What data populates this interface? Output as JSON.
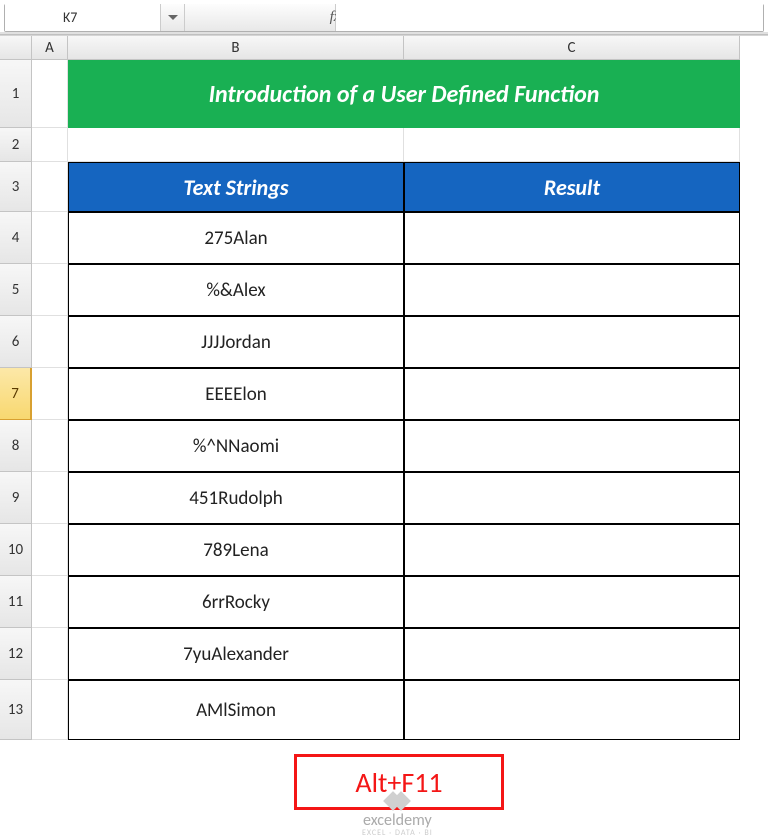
{
  "name_box": {
    "value": "K7"
  },
  "fx_label": "fx",
  "formula_value": "",
  "columns": [
    "A",
    "B",
    "C"
  ],
  "rows": [
    "1",
    "2",
    "3",
    "4",
    "5",
    "6",
    "7",
    "8",
    "9",
    "10",
    "11",
    "12",
    "13"
  ],
  "active_row": "7",
  "title": "Introduction of a User Defined Function",
  "table": {
    "headers": [
      "Text Strings",
      "Result"
    ],
    "rows": [
      {
        "text": "275Alan",
        "result": ""
      },
      {
        "text": "%&Alex",
        "result": ""
      },
      {
        "text": "JJJJordan",
        "result": ""
      },
      {
        "text": "EEEElon",
        "result": ""
      },
      {
        "text": "%^NNaomi",
        "result": ""
      },
      {
        "text": "451Rudolph",
        "result": ""
      },
      {
        "text": "789Lena",
        "result": ""
      },
      {
        "text": "6rrRocky",
        "result": ""
      },
      {
        "text": "7yuAlexander",
        "result": ""
      },
      {
        "text": "AMlSimon",
        "result": ""
      }
    ]
  },
  "callout": "Alt+F11",
  "watermark": {
    "brand": "exceldemy",
    "tagline": "EXCEL · DATA · BI"
  }
}
